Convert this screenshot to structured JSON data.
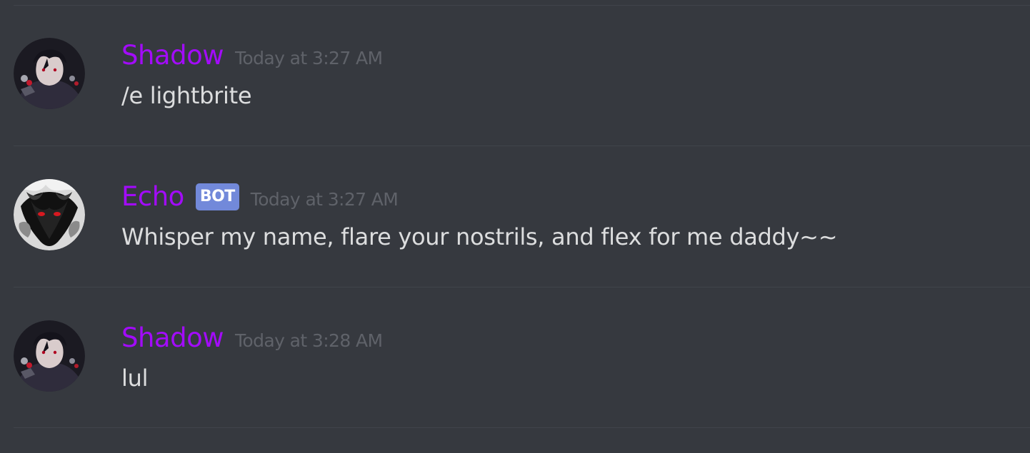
{
  "messages": [
    {
      "author": "Shadow",
      "timestamp": "Today at 3:27 AM",
      "content": "/e lightbrite",
      "avatar": "dark-anime-character-avatar"
    },
    {
      "author": "Echo",
      "bot_badge": "BOT",
      "timestamp": "Today at 3:27 AM",
      "content": "Whisper my name, flare your nostrils, and flex for me daddy~~",
      "avatar": "smoky-wolf-avatar"
    },
    {
      "author": "Shadow",
      "timestamp": "Today at 3:28 AM",
      "content": "lul",
      "avatar": "dark-anime-character-avatar"
    }
  ],
  "colors": {
    "background": "#36393f",
    "username": "#a30bfb",
    "timestamp": "#5f6269",
    "message_text": "#dcddde",
    "bot_badge": "#7289da",
    "divider": "#40444b"
  }
}
